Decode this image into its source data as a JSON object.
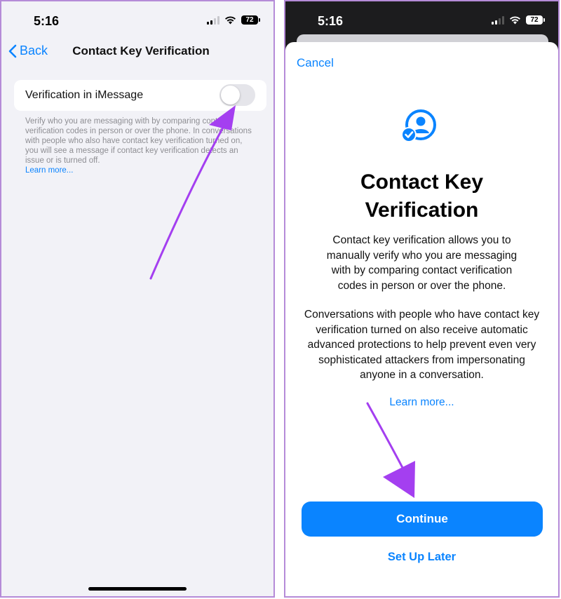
{
  "left_screen": {
    "status": {
      "time": "5:16",
      "battery": "72"
    },
    "nav": {
      "back_label": "Back",
      "title": "Contact Key Verification"
    },
    "setting": {
      "label": "Verification in iMessage",
      "enabled": false
    },
    "footer": {
      "text": "Verify who you are messaging with by comparing contact verification codes in person or over the phone. In conversations with people who also have contact key verification turned on, you will see a message if contact key verification detects an issue or is turned off.",
      "learn_more": "Learn more..."
    }
  },
  "right_screen": {
    "status": {
      "time": "5:16",
      "battery": "72"
    },
    "sheet": {
      "cancel_label": "Cancel",
      "title_line1": "Contact Key",
      "title_line2": "Verification",
      "paragraph1": "Contact key verification allows you to manually verify who you are messaging with by comparing contact verification codes in person or over the phone.",
      "paragraph2": "Conversations with people who have contact key verification turned on also receive automatic advanced protections to help prevent even very sophisticated attackers from impersonating anyone in a conversation.",
      "learn_more": "Learn more...",
      "continue_label": "Continue",
      "setup_later_label": "Set Up Later"
    }
  },
  "colors": {
    "accent": "#0a84ff",
    "annotation_arrow": "#a43ff0",
    "panel_border": "#b58bd8"
  },
  "icons": [
    "back-chevron-icon",
    "signal-icon",
    "wifi-icon",
    "battery-icon",
    "person-checkmark-icon"
  ]
}
